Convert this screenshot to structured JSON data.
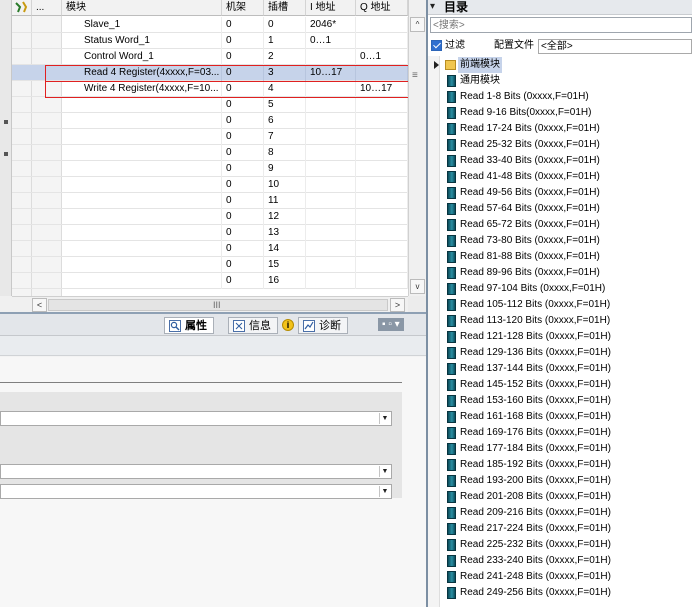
{
  "table": {
    "headers": {
      "icon": "",
      "dots": "...",
      "module": "模块",
      "rack": "机架",
      "slot": "插槽",
      "i_address": "I 地址",
      "q_address": "Q 地址"
    },
    "rows": [
      {
        "module": "Slave_1",
        "rack": "0",
        "slot": "0",
        "i_address": "2046*",
        "q_address": "",
        "selected": false
      },
      {
        "module": "Status Word_1",
        "rack": "0",
        "slot": "1",
        "i_address": "0…1",
        "q_address": "",
        "selected": false
      },
      {
        "module": "Control Word_1",
        "rack": "0",
        "slot": "2",
        "i_address": "",
        "q_address": "0…1",
        "selected": false
      },
      {
        "module": "Read 4 Register(4xxxx,F=03...",
        "rack": "0",
        "slot": "3",
        "i_address": "10…17",
        "q_address": "",
        "selected": true
      },
      {
        "module": "Write 4 Register(4xxxx,F=10...",
        "rack": "0",
        "slot": "4",
        "i_address": "",
        "q_address": "10…17",
        "selected": false
      },
      {
        "module": "",
        "rack": "0",
        "slot": "5",
        "i_address": "",
        "q_address": "",
        "selected": false
      },
      {
        "module": "",
        "rack": "0",
        "slot": "6",
        "i_address": "",
        "q_address": "",
        "selected": false
      },
      {
        "module": "",
        "rack": "0",
        "slot": "7",
        "i_address": "",
        "q_address": "",
        "selected": false
      },
      {
        "module": "",
        "rack": "0",
        "slot": "8",
        "i_address": "",
        "q_address": "",
        "selected": false
      },
      {
        "module": "",
        "rack": "0",
        "slot": "9",
        "i_address": "",
        "q_address": "",
        "selected": false
      },
      {
        "module": "",
        "rack": "0",
        "slot": "10",
        "i_address": "",
        "q_address": "",
        "selected": false
      },
      {
        "module": "",
        "rack": "0",
        "slot": "11",
        "i_address": "",
        "q_address": "",
        "selected": false
      },
      {
        "module": "",
        "rack": "0",
        "slot": "12",
        "i_address": "",
        "q_address": "",
        "selected": false
      },
      {
        "module": "",
        "rack": "0",
        "slot": "13",
        "i_address": "",
        "q_address": "",
        "selected": false
      },
      {
        "module": "",
        "rack": "0",
        "slot": "14",
        "i_address": "",
        "q_address": "",
        "selected": false
      },
      {
        "module": "",
        "rack": "0",
        "slot": "15",
        "i_address": "",
        "q_address": "",
        "selected": false
      },
      {
        "module": "",
        "rack": "0",
        "slot": "16",
        "i_address": "",
        "q_address": "",
        "selected": false
      }
    ],
    "scroll": {
      "up": "^",
      "down": "v",
      "left": "<",
      "right": ">",
      "grip": "III",
      "side_grip": "≡"
    }
  },
  "inspector": {
    "tabs": [
      {
        "label": "属性",
        "icon": "properties-icon",
        "active": true
      },
      {
        "label": "信息",
        "icon": "info-icon",
        "active": false
      },
      {
        "label": "诊断",
        "icon": "diagnostics-icon",
        "active": false
      }
    ],
    "info_badge": "i",
    "window_controls": "▪ ▫ ▾",
    "combos": [
      {
        "value": ""
      },
      {
        "value": ""
      },
      {
        "value": ""
      }
    ]
  },
  "catalog": {
    "title": "目录",
    "collapse_arrow": "▾",
    "search_placeholder": "<搜索>",
    "filter_label": "过滤",
    "filter_checked": true,
    "profile_label": "配置文件",
    "profile_value": "<全部>",
    "folder_label": "前端模块",
    "group_label": "通用模块",
    "items": [
      "Read 1-8 Bits (0xxxx,F=01H)",
      "Read 9-16 Bits(0xxxx,F=01H)",
      "Read 17-24 Bits (0xxxx,F=01H)",
      "Read 25-32 Bits (0xxxx,F=01H)",
      "Read 33-40 Bits (0xxxx,F=01H)",
      "Read 41-48 Bits (0xxxx,F=01H)",
      "Read 49-56 Bits (0xxxx,F=01H)",
      "Read 57-64 Bits (0xxxx,F=01H)",
      "Read 65-72 Bits (0xxxx,F=01H)",
      "Read 73-80 Bits (0xxxx,F=01H)",
      "Read 81-88 Bits (0xxxx,F=01H)",
      "Read 89-96 Bits (0xxxx,F=01H)",
      "Read 97-104 Bits (0xxxx,F=01H)",
      "Read 105-112 Bits (0xxxx,F=01H)",
      "Read 113-120 Bits (0xxxx,F=01H)",
      "Read 121-128 Bits (0xxxx,F=01H)",
      "Read 129-136 Bits (0xxxx,F=01H)",
      "Read 137-144 Bits (0xxxx,F=01H)",
      "Read 145-152 Bits (0xxxx,F=01H)",
      "Read 153-160 Bits (0xxxx,F=01H)",
      "Read 161-168 Bits (0xxxx,F=01H)",
      "Read 169-176 Bits (0xxxx,F=01H)",
      "Read 177-184 Bits (0xxxx,F=01H)",
      "Read 185-192 Bits (0xxxx,F=01H)",
      "Read 193-200 Bits (0xxxx,F=01H)",
      "Read 201-208 Bits (0xxxx,F=01H)",
      "Read 209-216 Bits (0xxxx,F=01H)",
      "Read 217-224 Bits (0xxxx,F=01H)",
      "Read 225-232 Bits (0xxxx,F=01H)",
      "Read 233-240 Bits (0xxxx,F=01H)",
      "Read 241-248 Bits (0xxxx,F=01H)",
      "Read 249-256 Bits (0xxxx,F=01H)"
    ]
  },
  "colors": {
    "selection": "#c6d3ea",
    "highlight_box": "#e02020",
    "folder": "#f0c650",
    "module_icon": "#1a6b7c"
  }
}
